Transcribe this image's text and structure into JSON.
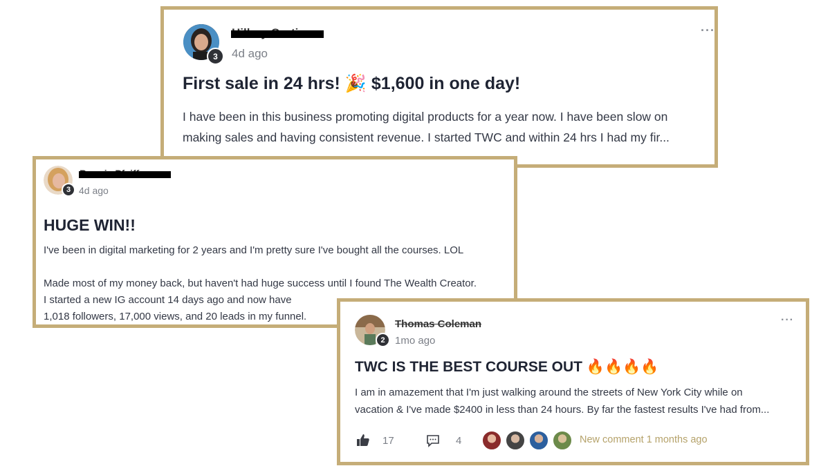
{
  "posts": [
    {
      "author": "Hillary Cortivo",
      "level": "3",
      "time": "4d ago",
      "title": "First sale in 24 hrs! 🎉 $1,600 in one day!",
      "body_lines": [
        "I have been in this business promoting digital products for a year now. I have been slow on",
        "making sales and having consistent revenue. I started TWC and within 24 hrs I had my fir..."
      ],
      "more": "···"
    },
    {
      "author": "Bonnie Pfeiffer",
      "level": "3",
      "time": "4d ago",
      "title": "HUGE WIN!!",
      "body_lines": [
        "I've been in digital marketing for 2 years and I'm pretty sure I've bought all the courses. LOL",
        "",
        "Made most of my money back, but haven't had huge success until I found The Wealth Creator.",
        "I started a new IG account 14 days ago and now have",
        "1,018 followers, 17,000 views, and 20 leads in my funnel."
      ]
    },
    {
      "author": "Thomas Coleman",
      "level": "2",
      "time": "1mo ago",
      "title": "TWC IS THE BEST COURSE OUT 🔥🔥🔥🔥",
      "body_lines": [
        "I am in amazement that I'm just walking around the streets of New York City while on",
        "vacation & I've made $2400 in less than 24 hours. By far the fastest results I've had from..."
      ],
      "more": "···",
      "likes": "17",
      "comments": "4",
      "new_comment": "New comment 1 months ago"
    }
  ],
  "colors": {
    "frame_gold": "#c5ad78",
    "accent_gold": "#b5a26a"
  },
  "icons": {
    "like": "thumbs-up-icon",
    "comment": "comment-icon"
  }
}
